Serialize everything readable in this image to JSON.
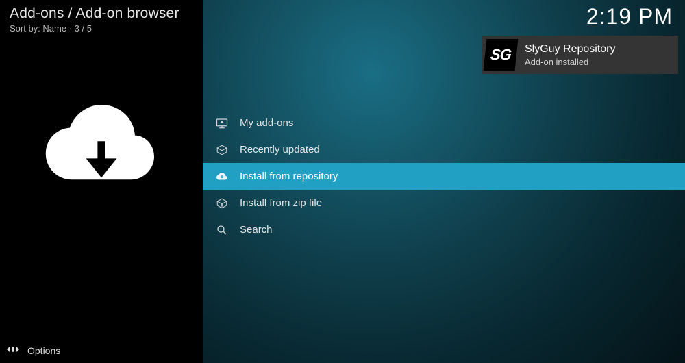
{
  "header": {
    "breadcrumb": "Add-ons / Add-on browser",
    "sort_prefix": "Sort by: ",
    "sort_field": "Name",
    "sort_sep": "  ·  ",
    "position": "3 / 5"
  },
  "clock": "2:19 PM",
  "notification": {
    "badge": "SG",
    "title": "SlyGuy Repository",
    "subtitle": "Add-on installed"
  },
  "menu": {
    "items": [
      {
        "label": "My add-ons"
      },
      {
        "label": "Recently updated"
      },
      {
        "label": "Install from repository",
        "selected": true
      },
      {
        "label": "Install from zip file"
      },
      {
        "label": "Search"
      }
    ]
  },
  "footer": {
    "options": "Options"
  }
}
